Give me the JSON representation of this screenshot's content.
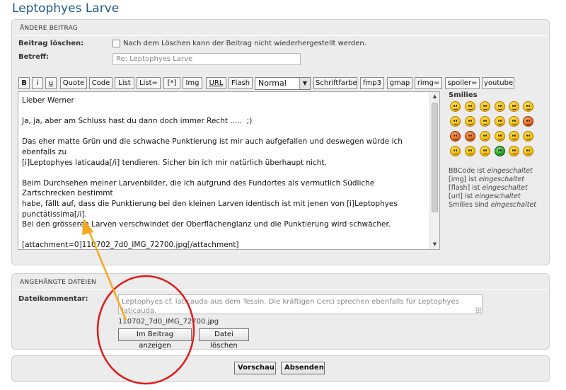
{
  "page_title": "Leptophyes Larve",
  "edit_panel": {
    "header": "ÄNDERE BEITRAG",
    "delete_label": "Beitrag löschen:",
    "delete_note": "Nach dem Löschen kann der Beitrag nicht wiederhergestellt werden.",
    "subject_label": "Betreff:",
    "subject_value": "Re: Leptophyes Larve"
  },
  "toolbar": {
    "bold": "B",
    "italic": "i",
    "underline": "u",
    "quote": "Quote",
    "code": "Code",
    "list": "List",
    "list_eq": "List=",
    "list_item": "[*]",
    "img": "Img",
    "url": "URL",
    "flash": "Flash",
    "size_selected": "Normal",
    "font_color": "Schriftfarbe",
    "fmp3": "fmp3",
    "gmap": "gmap",
    "rimg": "rimg=",
    "spoiler": "spoiler=",
    "youtube": "youtube"
  },
  "editor": {
    "text": "Lieber Werner\n\nJa, ja, aber am Schluss hast du dann doch immer Recht .....  ;)\n\nDas eher matte Grün und die schwache Punktierung ist mir auch aufgefallen und deswegen würde ich ebenfalls zu\n[i]Leptophyes laticauda[/i] tendieren. Sicher bin ich mir natürlich überhaupt nicht.\n\nBeim Durchsehen meiner Larvenbilder, die ich aufgrund des Fundortes als vermutlich Südliche Zartschrecken bestimmt\nhabe, fällt auf, dass die Punktierung bei den kleinen Larven identisch ist mit jenen von [i]Leptophyes punctatissima[/i].\nBei den grösseren Larven verschwindet der Oberflächenglanz und die Punktierung wird schwächer.\n\n[attachment=0]110702_7d0_IMG_72700.jpg[/attachment]\n\nBei den Flügelanlagen meine ich sind sie bei beiden Bildern etwa gleich eintwickelt.\n\nDa haben wir auf jeden Fall wieder Stoff für die nächste Saision."
  },
  "smilies": {
    "title": "Smilies",
    "bbcode_prefix": "BBCode ist ",
    "bbcode_state": "eingeschaltet",
    "img_prefix": "[img] ist ",
    "img_state": "eingeschaltet",
    "flash_prefix": "[flash] ist ",
    "flash_state": "eingeschaltet",
    "url_prefix": "[url] ist ",
    "url_state": "eingeschaltet",
    "smilies_prefix": "Smilies sind ",
    "smilies_state": "eingeschaltet"
  },
  "attachments": {
    "header": "ANGEHÄNGTE DATEIEN",
    "comment_label": "Dateikommentar:",
    "comment_value": "Leptophyes cf. laticauda aus dem Tessin. Die kräftigen Cerci sprechen ebenfalls für Leptophyes laticauda.",
    "filename": "110702_7d0_IMG_72700.jpg",
    "show_button": "Im Beitrag anzeigen",
    "delete_button": "Datei löschen"
  },
  "actions": {
    "preview": "Vorschau",
    "submit": "Absenden"
  },
  "annotation": {
    "color": "#f4a91e",
    "circle_color": "#e01b1b"
  }
}
